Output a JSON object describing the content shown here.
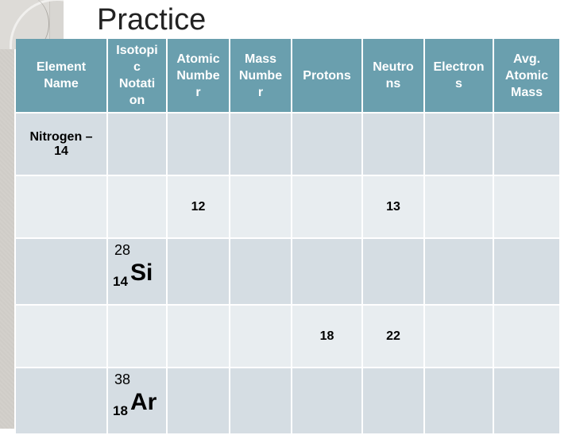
{
  "slide": {
    "title": "Practice"
  },
  "table": {
    "headers": [
      "Element Name",
      "Isotopic Notation",
      "Atomic Number",
      "Mass Number",
      "Protons",
      "Neutrons",
      "Electrons",
      "Avg. Atomic Mass"
    ],
    "header_lines": [
      [
        "Element",
        "Name"
      ],
      [
        "Isotopi",
        "c",
        "Notati",
        "on"
      ],
      [
        "Atomic",
        "Numbe",
        "r"
      ],
      [
        "Mass",
        "Numbe",
        "r"
      ],
      [
        "Protons"
      ],
      [
        "Neutro",
        "ns"
      ],
      [
        "Electron",
        "s"
      ],
      [
        "Avg.",
        "Atomic",
        "Mass"
      ]
    ],
    "rows": [
      {
        "element_name": [
          "Nitrogen –",
          "14"
        ],
        "notation": null,
        "atomic_number": "",
        "mass_number": "",
        "protons": "",
        "neutrons": "",
        "electrons": "",
        "avg_atomic_mass": ""
      },
      {
        "element_name": "",
        "notation": null,
        "atomic_number": "12",
        "mass_number": "",
        "protons": "",
        "neutrons": "13",
        "electrons": "",
        "avg_atomic_mass": ""
      },
      {
        "element_name": "",
        "notation": {
          "mass": "28",
          "atomic": "14",
          "symbol": "Si"
        },
        "atomic_number": "",
        "mass_number": "",
        "protons": "",
        "neutrons": "",
        "electrons": "",
        "avg_atomic_mass": ""
      },
      {
        "element_name": "",
        "notation": null,
        "atomic_number": "",
        "mass_number": "",
        "protons": "18",
        "neutrons": "22",
        "electrons": "",
        "avg_atomic_mass": ""
      },
      {
        "element_name": "",
        "notation": {
          "mass": "38",
          "atomic": "18",
          "symbol": "Ar"
        },
        "atomic_number": "",
        "mass_number": "",
        "protons": "",
        "neutrons": "",
        "electrons": "",
        "avg_atomic_mass": ""
      }
    ]
  },
  "colors": {
    "header_bg": "#6a9fae",
    "row_dark": "#d5dde3",
    "row_light": "#e8edf0"
  }
}
